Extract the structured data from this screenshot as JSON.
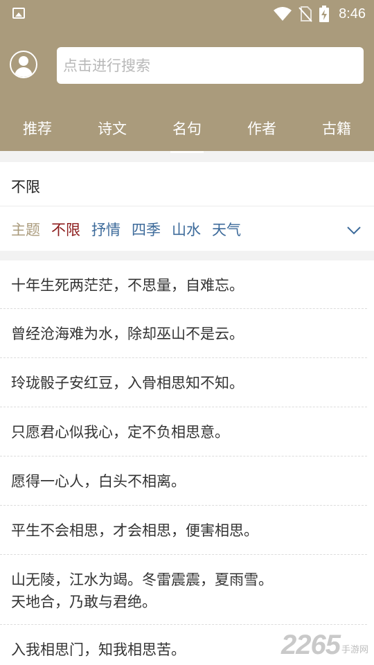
{
  "status_bar": {
    "time": "8:46"
  },
  "header": {
    "search_placeholder": "点击进行搜索"
  },
  "tabs": [
    {
      "label": "推荐"
    },
    {
      "label": "诗文"
    },
    {
      "label": "名句",
      "active": true
    },
    {
      "label": "作者"
    },
    {
      "label": "古籍"
    }
  ],
  "filter": {
    "current": "不限",
    "theme_label": "主题",
    "selected": "不限",
    "tags": [
      "抒情",
      "四季",
      "山水",
      "天气"
    ]
  },
  "quotes": [
    {
      "text": "十年生死两茫茫，不思量，自难忘。"
    },
    {
      "text": "曾经沧海难为水，除却巫山不是云。"
    },
    {
      "text": "玲珑骰子安红豆，入骨相思知不知。"
    },
    {
      "text": "只愿君心似我心，定不负相思意。"
    },
    {
      "text": "愿得一心人，白头不相离。"
    },
    {
      "text": "平生不会相思，才会相思，便害相思。"
    },
    {
      "text": "山无陵，江水为竭。冬雷震震，夏雨雪。\n天地合，乃敢与君绝。"
    },
    {
      "text": "入我相思门，知我相思苦。"
    }
  ],
  "watermark": {
    "number": "2265",
    "sub": "手游网"
  },
  "colors": {
    "header_bg": "#aa9b7c",
    "theme_label": "#aa9b7c",
    "selected_tag": "#8b1a1a",
    "tag": "#3c6a9a"
  }
}
